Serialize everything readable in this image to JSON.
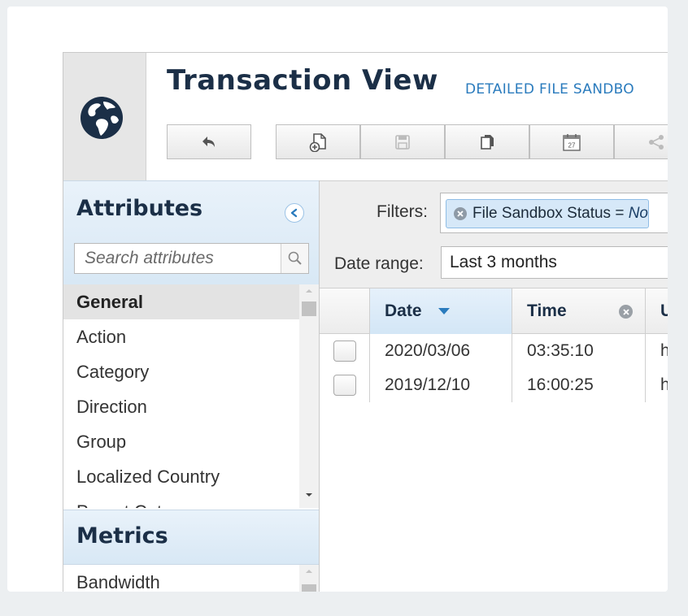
{
  "header": {
    "title": "Transaction View",
    "subtitle": "DETAILED FILE SANDBO",
    "logo_icon": "globe-icon",
    "toolbar": [
      {
        "name": "back-button",
        "icon": "undo-arrow-icon",
        "enabled": true
      },
      {
        "name": "new-button",
        "icon": "new-document-icon",
        "enabled": true
      },
      {
        "name": "save-button",
        "icon": "save-icon",
        "enabled": false
      },
      {
        "name": "copy-button",
        "icon": "copy-icon",
        "enabled": true
      },
      {
        "name": "schedule-button",
        "icon": "calendar-icon",
        "enabled": true,
        "calendar_day": "27"
      },
      {
        "name": "share-button",
        "icon": "share-icon",
        "enabled": false
      }
    ]
  },
  "sidebar": {
    "attributes_title": "Attributes",
    "search_placeholder": "Search attributes",
    "attribute_items": [
      {
        "label": "General",
        "selected": true
      },
      {
        "label": "Action",
        "selected": false
      },
      {
        "label": "Category",
        "selected": false
      },
      {
        "label": "Direction",
        "selected": false
      },
      {
        "label": "Group",
        "selected": false
      },
      {
        "label": "Localized Country",
        "selected": false
      },
      {
        "label": "Parent Category",
        "selected": false
      }
    ],
    "metrics_title": "Metrics",
    "metric_items": [
      {
        "label": "Bandwidth"
      }
    ]
  },
  "main": {
    "filters_label": "Filters:",
    "filter_chip": {
      "field": "File Sandbox Status = ",
      "value": "No "
    },
    "daterange_label": "Date range:",
    "daterange_value": "Last 3 months",
    "grid": {
      "columns": [
        {
          "label": "Date",
          "sorted": "desc"
        },
        {
          "label": "Time",
          "removable": true
        },
        {
          "label": "UI"
        }
      ],
      "rows": [
        {
          "date": "2020/03/06",
          "time": "03:35:10",
          "url": "ht"
        },
        {
          "date": "2019/12/10",
          "time": "16:00:25",
          "url": "ht"
        }
      ]
    }
  },
  "colors": {
    "title": "#1b2f47",
    "accent_blue": "#2a7bbd",
    "panel_head": "#d8e8f5",
    "selected_row": "#e3e3e3"
  }
}
